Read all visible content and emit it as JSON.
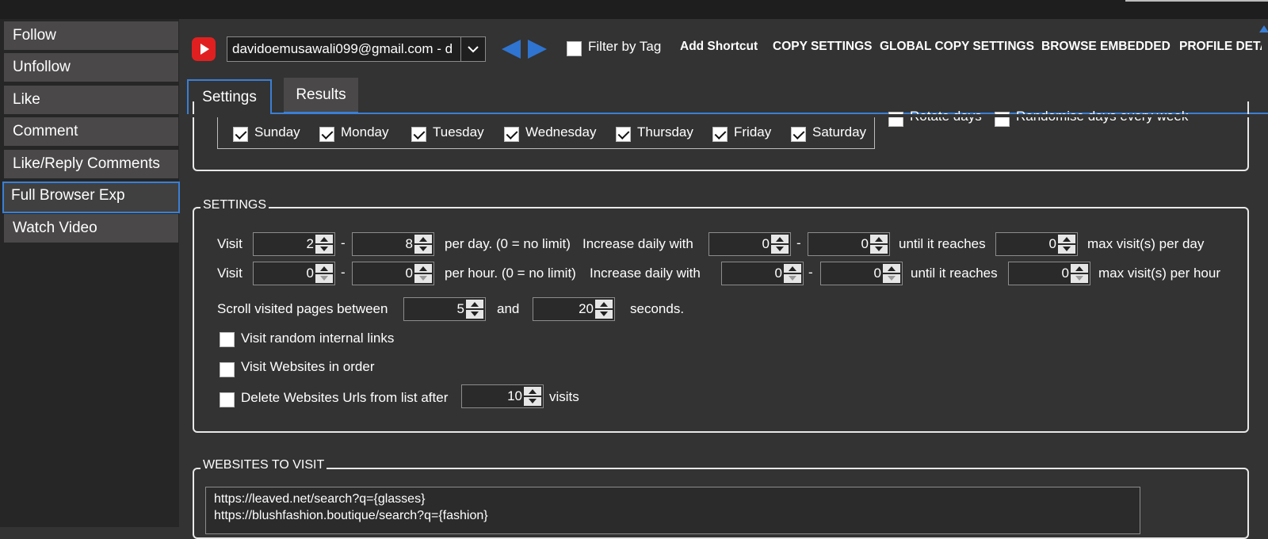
{
  "sidebar": {
    "items": [
      {
        "label": "Follow"
      },
      {
        "label": "Unfollow"
      },
      {
        "label": "Like"
      },
      {
        "label": "Comment"
      },
      {
        "label": "Like/Reply Comments"
      },
      {
        "label": "Full Browser Exp",
        "active": true
      },
      {
        "label": "Watch Video"
      }
    ]
  },
  "toolbar": {
    "account_value": "davidoemusawali099@gmail.com - d",
    "filter_by_tag_label": "Filter by Tag",
    "filter_by_tag_checked": false,
    "buttons": [
      "Add Shortcut",
      "COPY SETTINGS",
      "GLOBAL COPY SETTINGS",
      "BROWSE EMBEDDED",
      "PROFILE DETAI"
    ]
  },
  "tabs": [
    {
      "label": "Settings",
      "active": true
    },
    {
      "label": "Results",
      "active": false
    }
  ],
  "days": {
    "items": [
      {
        "label": "Sunday",
        "checked": true
      },
      {
        "label": "Monday",
        "checked": true
      },
      {
        "label": "Tuesday",
        "checked": true
      },
      {
        "label": "Wednesday",
        "checked": true
      },
      {
        "label": "Thursday",
        "checked": true
      },
      {
        "label": "Friday",
        "checked": true
      },
      {
        "label": "Saturday",
        "checked": true
      }
    ],
    "rotate_days_label": "Rotate days",
    "rotate_days_checked": false,
    "randomise_label": "Randomise days every week",
    "randomise_checked": false
  },
  "settings": {
    "legend": "SETTINGS",
    "row1": {
      "visit_label": "Visit",
      "dash": "-",
      "min": "2",
      "max": "8",
      "per_label": "per day. (0 = no limit)",
      "increase_label": "Increase daily with",
      "inc_min": "0",
      "inc_max": "0",
      "until_label": "until it reaches",
      "reach": "0",
      "max_label": "max visit(s) per day"
    },
    "row2": {
      "visit_label": "Visit",
      "dash": "-",
      "min": "0",
      "max": "0",
      "per_label": "per hour. (0 = no limit)",
      "increase_label": "Increase daily with",
      "inc_min": "0",
      "inc_max": "0",
      "until_label": "until it reaches",
      "reach": "0",
      "max_label": "max visit(s) per hour"
    },
    "scroll": {
      "label": "Scroll visited pages between",
      "min": "5",
      "and_label": "and",
      "max": "20",
      "seconds_label": "seconds."
    },
    "visit_random_label": "Visit random internal links",
    "visit_random_checked": false,
    "visit_order_label": "Visit Websites in order",
    "visit_order_checked": false,
    "delete_label": "Delete Websites Urls from list after",
    "delete_checked": false,
    "delete_value": "10",
    "visits_label": "visits"
  },
  "websites": {
    "legend": "WEBSITES TO VISIT",
    "lines": [
      "https://leaved.net/search?q={glasses}",
      "https://blushfashion.boutique/search?q={fashion}"
    ]
  },
  "colors": {
    "accent": "#3a7fd6",
    "background": "#333333",
    "youtube": "#e02020"
  }
}
